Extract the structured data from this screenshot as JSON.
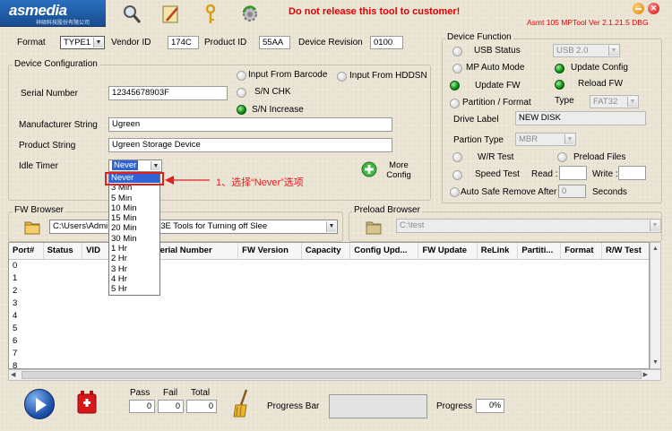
{
  "header": {
    "logo_text": "asmedia",
    "logo_sub": "祥硕科技股份有限公司",
    "warning": "Do not release this tool to customer!",
    "version": "Asmt 105 MPTool Ver 2.1.21.5 DBG"
  },
  "top": {
    "format_label": "Format",
    "format_value": "TYPE1",
    "vendor_label": "Vendor ID",
    "vendor_value": "174C",
    "product_label": "Product ID",
    "product_value": "55AA",
    "revision_label": "Device Revision",
    "revision_value": "0100"
  },
  "devconf": {
    "title": "Device Configuration",
    "input_barcode": "Input From Barcode",
    "input_hdd": "Input From HDDSN",
    "sn_chk": "S/N CHK",
    "sn_increase": "S/N Increase",
    "serial_label": "Serial Number",
    "serial_value": "12345678903F",
    "mfr_label": "Manufacturer String",
    "mfr_value": "Ugreen",
    "prod_label": "Product String",
    "prod_value": "Ugreen Storage Device",
    "idle_label": "Idle Timer",
    "idle_value": "Never",
    "more_config": "More Config"
  },
  "dropdown": {
    "options": [
      "Never",
      "3 Min",
      "5 Min",
      "10 Min",
      "15 Min",
      "20 Min",
      "30 Min",
      "1 Hr",
      "2 Hr",
      "3 Hr",
      "4 Hr",
      "5 Hr"
    ]
  },
  "annotation": {
    "text": "1、选择“Never”选项"
  },
  "devfunc": {
    "title": "Device Function",
    "usb_status": "USB Status",
    "usb_value": "USB 2.0",
    "mp_auto": "MP Auto Mode",
    "update_config": "Update Config",
    "update_fw": "Update FW",
    "reload_fw": "Reload FW",
    "partition": "Partition / Format",
    "type_label": "Type",
    "type_value": "FAT32",
    "drive_label": "Drive Label",
    "drive_value": "NEW DISK",
    "partion_type_label": "Partion Type",
    "partion_type_value": "MBR",
    "wr_test": "W/R Test",
    "preload_files": "Preload Files",
    "speed_test": "Speed Test",
    "read_label": "Read :",
    "write_label": "Write :",
    "auto_safe": "Auto Safe Remove After",
    "auto_safe_value": "0",
    "seconds": "Seconds"
  },
  "fw_browser": {
    "title": "FW Browser",
    "path": "C:\\Users\\Admi                ktop\\ASM1153E Tools for Turning off Slee"
  },
  "preload_browser": {
    "title": "Preload Browser",
    "path": "C:\\test"
  },
  "table": {
    "columns": [
      "Port#",
      "Status",
      "VID",
      "",
      "Serial Number",
      "FW Version",
      "Capacity",
      "Config Upd...",
      "FW Update",
      "ReLink",
      "Partiti...",
      "Format",
      "R/W Test",
      "Preload"
    ],
    "rows": [
      "0",
      "1",
      "2",
      "3",
      "4",
      "5",
      "6",
      "7",
      "8"
    ]
  },
  "bottom": {
    "pass_label": "Pass",
    "fail_label": "Fail",
    "total_label": "Total",
    "pass_value": "0",
    "fail_value": "0",
    "total_value": "0",
    "progress_bar_label": "Progress Bar",
    "progress_label": "Progress",
    "progress_value": "0%"
  },
  "colors": {
    "accent_red": "#e00000",
    "logo_blue": "#1d5ca8",
    "led_green": "#0f8a0f",
    "selection_blue": "#3064d4"
  }
}
